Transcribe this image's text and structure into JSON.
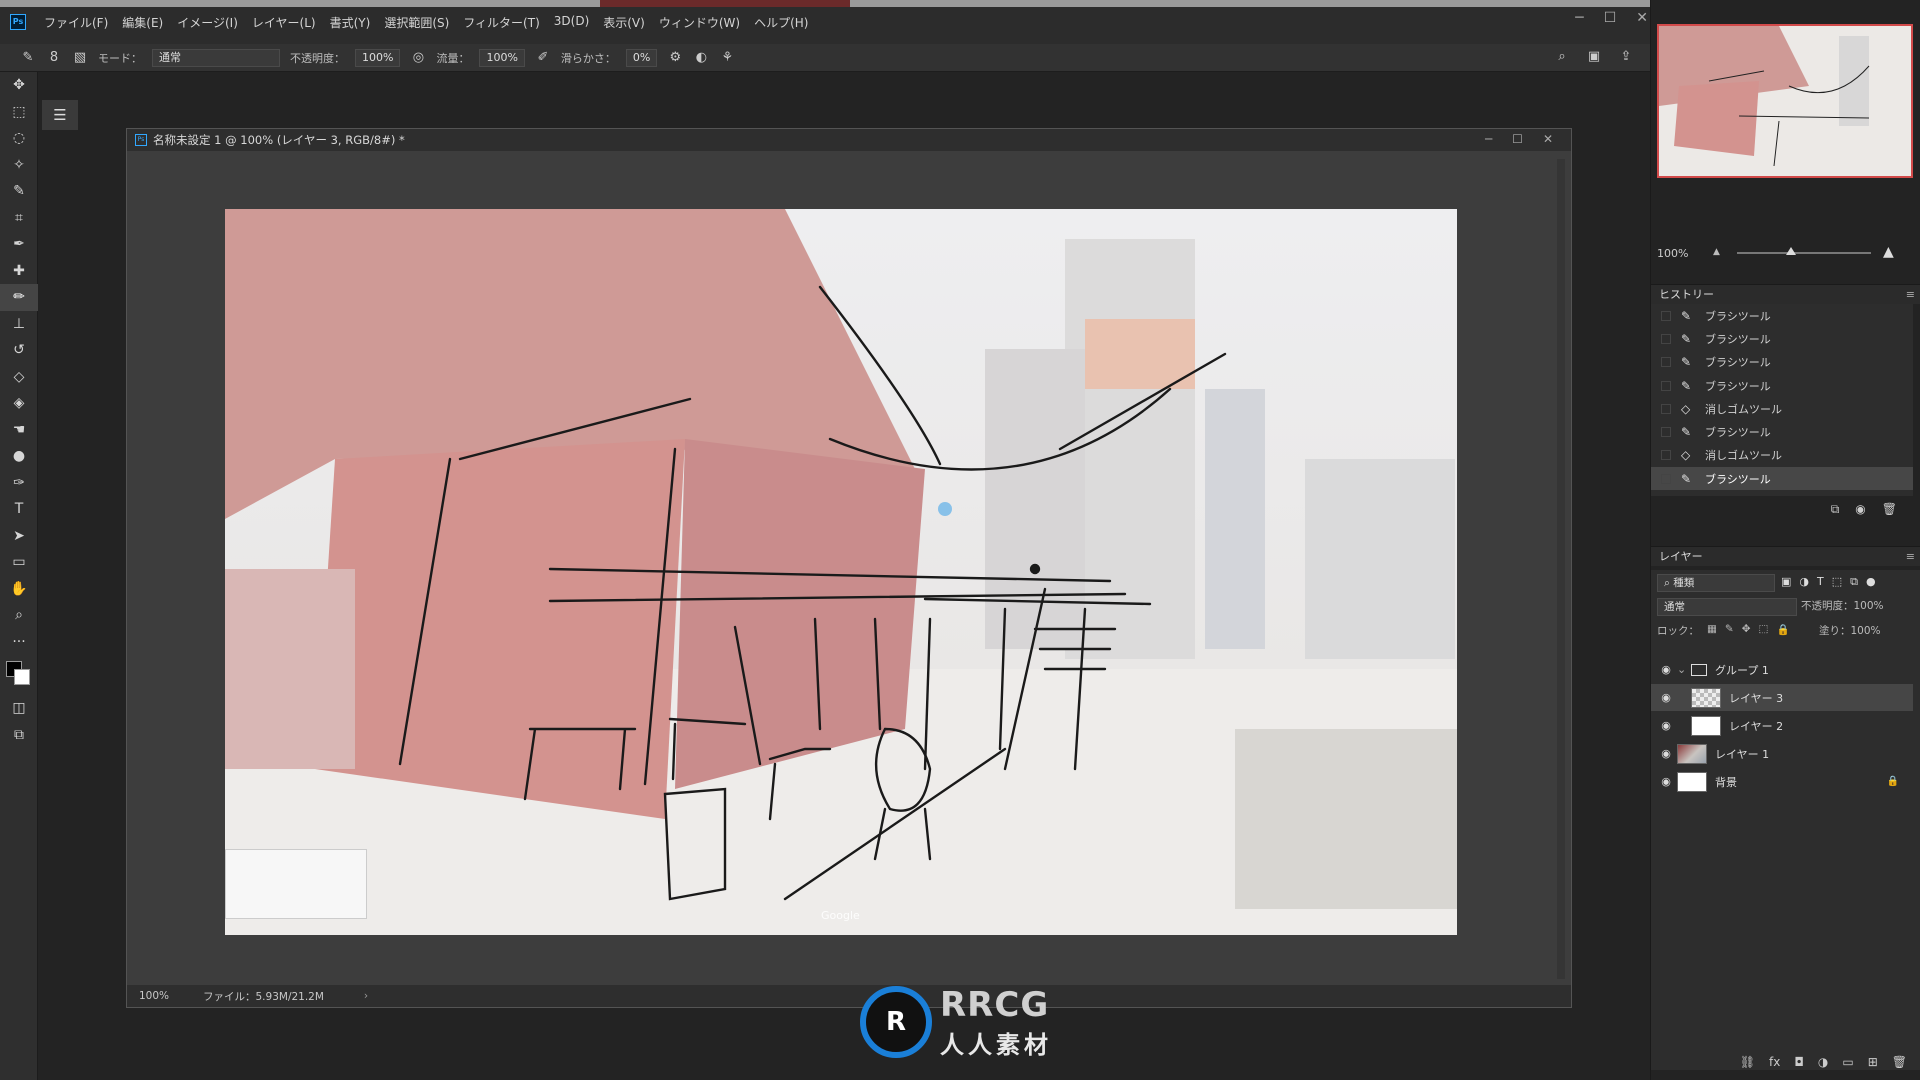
{
  "menubar": {
    "items": [
      "ファイル(F)",
      "編集(E)",
      "イメージ(I)",
      "レイヤー(L)",
      "書式(Y)",
      "選択範囲(S)",
      "フィルター(T)",
      "3D(D)",
      "表示(V)",
      "ウィンドウ(W)",
      "ヘルプ(H)"
    ],
    "window_controls": [
      "─",
      "☐",
      "✕"
    ]
  },
  "options": {
    "brush_size": "8",
    "mode_label": "モード：",
    "mode_value": "通常",
    "opacity_label": "不透明度：",
    "opacity_value": "100%",
    "flow_label": "流量：",
    "flow_value": "100%",
    "smoothing_label": "滑らかさ：",
    "smoothing_value": "0%"
  },
  "document": {
    "title": "名称未設定 1 @ 100% (レイヤー 3, RGB/8#) *",
    "zoom": "100%",
    "file_info": "ファイル：5.93M/21.2M",
    "google_mark": "Google"
  },
  "navigator": {
    "zoom": "100%",
    "zoom_slider_fraction": 0.4
  },
  "history": {
    "title": "ヒストリー",
    "items": [
      {
        "icon": "brush-icon",
        "label": "ブラシツール"
      },
      {
        "icon": "brush-icon",
        "label": "ブラシツール"
      },
      {
        "icon": "brush-icon",
        "label": "ブラシツール"
      },
      {
        "icon": "brush-icon",
        "label": "ブラシツール"
      },
      {
        "icon": "eraser-icon",
        "label": "消しゴムツール"
      },
      {
        "icon": "brush-icon",
        "label": "ブラシツール"
      },
      {
        "icon": "eraser-icon",
        "label": "消しゴムツール"
      },
      {
        "icon": "brush-icon",
        "label": "ブラシツール"
      }
    ]
  },
  "layers": {
    "title": "レイヤー",
    "filter": "種類",
    "blend": "通常",
    "opacity_label": "不透明度：",
    "opacity_value": "100%",
    "lock_label": "ロック：",
    "fill_label": "塗り：",
    "fill_value": "100%",
    "items": [
      {
        "name": "グループ 1",
        "kind": "group"
      },
      {
        "name": "レイヤー 3",
        "kind": "layer",
        "active": true
      },
      {
        "name": "レイヤー 2",
        "kind": "layer"
      },
      {
        "name": "レイヤー 1",
        "kind": "photo"
      },
      {
        "name": "背景",
        "kind": "background",
        "locked": true
      }
    ]
  },
  "watermark": {
    "logo": "R",
    "line1": "RRCG",
    "line2": "人人素材"
  },
  "colors": {
    "accent_blue": "#31a8ff",
    "panel_bg": "#2d2d2d",
    "app_bg": "#232323",
    "nav_frame": "#d24a4a"
  }
}
